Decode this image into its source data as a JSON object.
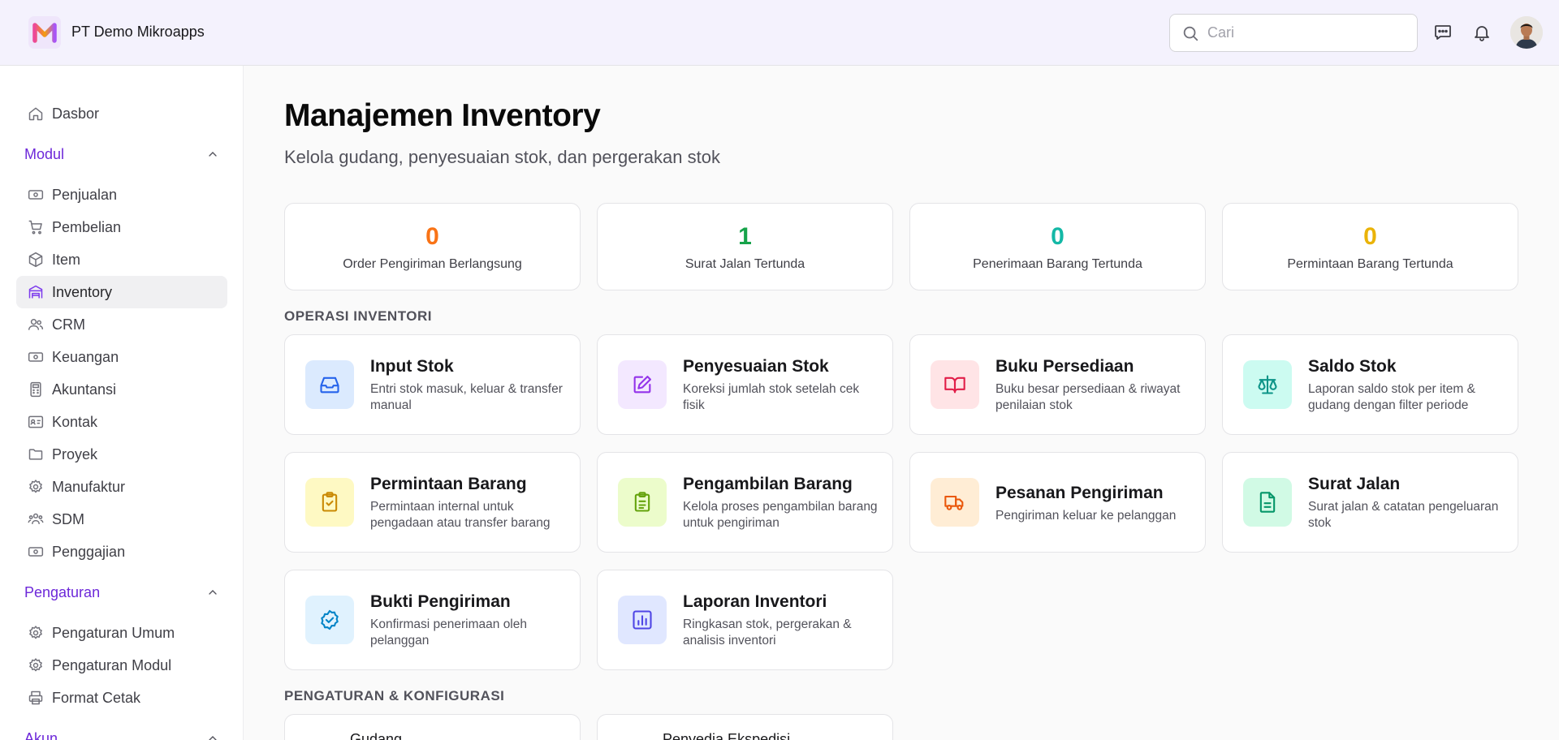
{
  "header": {
    "company": "PT Demo Mikroapps",
    "search_placeholder": "Cari"
  },
  "sidebar": {
    "dashboard": "Dasbor",
    "modules_title": "Modul",
    "modules": [
      {
        "label": "Penjualan",
        "icon": "banknote-icon"
      },
      {
        "label": "Pembelian",
        "icon": "cart-icon"
      },
      {
        "label": "Item",
        "icon": "box-icon"
      },
      {
        "label": "Inventory",
        "icon": "warehouse-icon"
      },
      {
        "label": "CRM",
        "icon": "users-icon"
      },
      {
        "label": "Keuangan",
        "icon": "banknote-icon"
      },
      {
        "label": "Akuntansi",
        "icon": "calculator-icon"
      },
      {
        "label": "Kontak",
        "icon": "contact-card-icon"
      },
      {
        "label": "Proyek",
        "icon": "folder-icon"
      },
      {
        "label": "Manufaktur",
        "icon": "gear-icon"
      },
      {
        "label": "SDM",
        "icon": "team-icon"
      },
      {
        "label": "Penggajian",
        "icon": "banknote-icon"
      }
    ],
    "settings_title": "Pengaturan",
    "settings": [
      {
        "label": "Pengaturan Umum",
        "icon": "gear-icon"
      },
      {
        "label": "Pengaturan Modul",
        "icon": "gear-icon"
      },
      {
        "label": "Format Cetak",
        "icon": "printer-icon"
      }
    ],
    "account_title": "Akun",
    "active_color": "#6d28d9"
  },
  "page": {
    "title": "Manajemen Inventory",
    "subtitle": "Kelola gudang, penyesuaian stok, dan pergerakan stok"
  },
  "stats": [
    {
      "value": "0",
      "label": "Order Pengiriman Berlangsung",
      "color": "#f97316"
    },
    {
      "value": "1",
      "label": "Surat Jalan Tertunda",
      "color": "#16a34a"
    },
    {
      "value": "0",
      "label": "Penerimaan Barang Tertunda",
      "color": "#14b8a6"
    },
    {
      "value": "0",
      "label": "Permintaan Barang Tertunda",
      "color": "#eab308"
    }
  ],
  "operations": {
    "title": "OPERASI INVENTORI",
    "cards": [
      {
        "title": "Input Stok",
        "desc": "Entri stok masuk, keluar & transfer manual",
        "icon": "inbox-icon"
      },
      {
        "title": "Penyesuaian Stok",
        "desc": "Koreksi jumlah stok setelah cek fisik",
        "icon": "edit-icon"
      },
      {
        "title": "Buku Persediaan",
        "desc": "Buku besar persediaan & riwayat penilaian stok",
        "icon": "book-icon"
      },
      {
        "title": "Saldo Stok",
        "desc": "Laporan saldo stok per item & gudang dengan filter periode",
        "icon": "scale-icon"
      },
      {
        "title": "Permintaan Barang",
        "desc": "Permintaan internal untuk pengadaan atau transfer barang",
        "icon": "clipboard-check-icon"
      },
      {
        "title": "Pengambilan Barang",
        "desc": "Kelola proses pengambilan barang untuk pengiriman",
        "icon": "clipboard-list-icon"
      },
      {
        "title": "Pesanan Pengiriman",
        "desc": "Pengiriman keluar ke pelanggan",
        "icon": "truck-icon"
      },
      {
        "title": "Surat Jalan",
        "desc": "Surat jalan & catatan pengeluaran stok",
        "icon": "file-text-icon"
      },
      {
        "title": "Bukti Pengiriman",
        "desc": "Konfirmasi penerimaan oleh pelanggan",
        "icon": "badge-check-icon"
      },
      {
        "title": "Laporan Inventori",
        "desc": "Ringkasan stok, pergerakan & analisis inventori",
        "icon": "bar-chart-icon"
      }
    ]
  },
  "configuration": {
    "title": "PENGATURAN & KONFIGURASI",
    "cards": [
      {
        "title": "Gudang"
      },
      {
        "title": "Penyedia Ekspedisi"
      }
    ]
  }
}
